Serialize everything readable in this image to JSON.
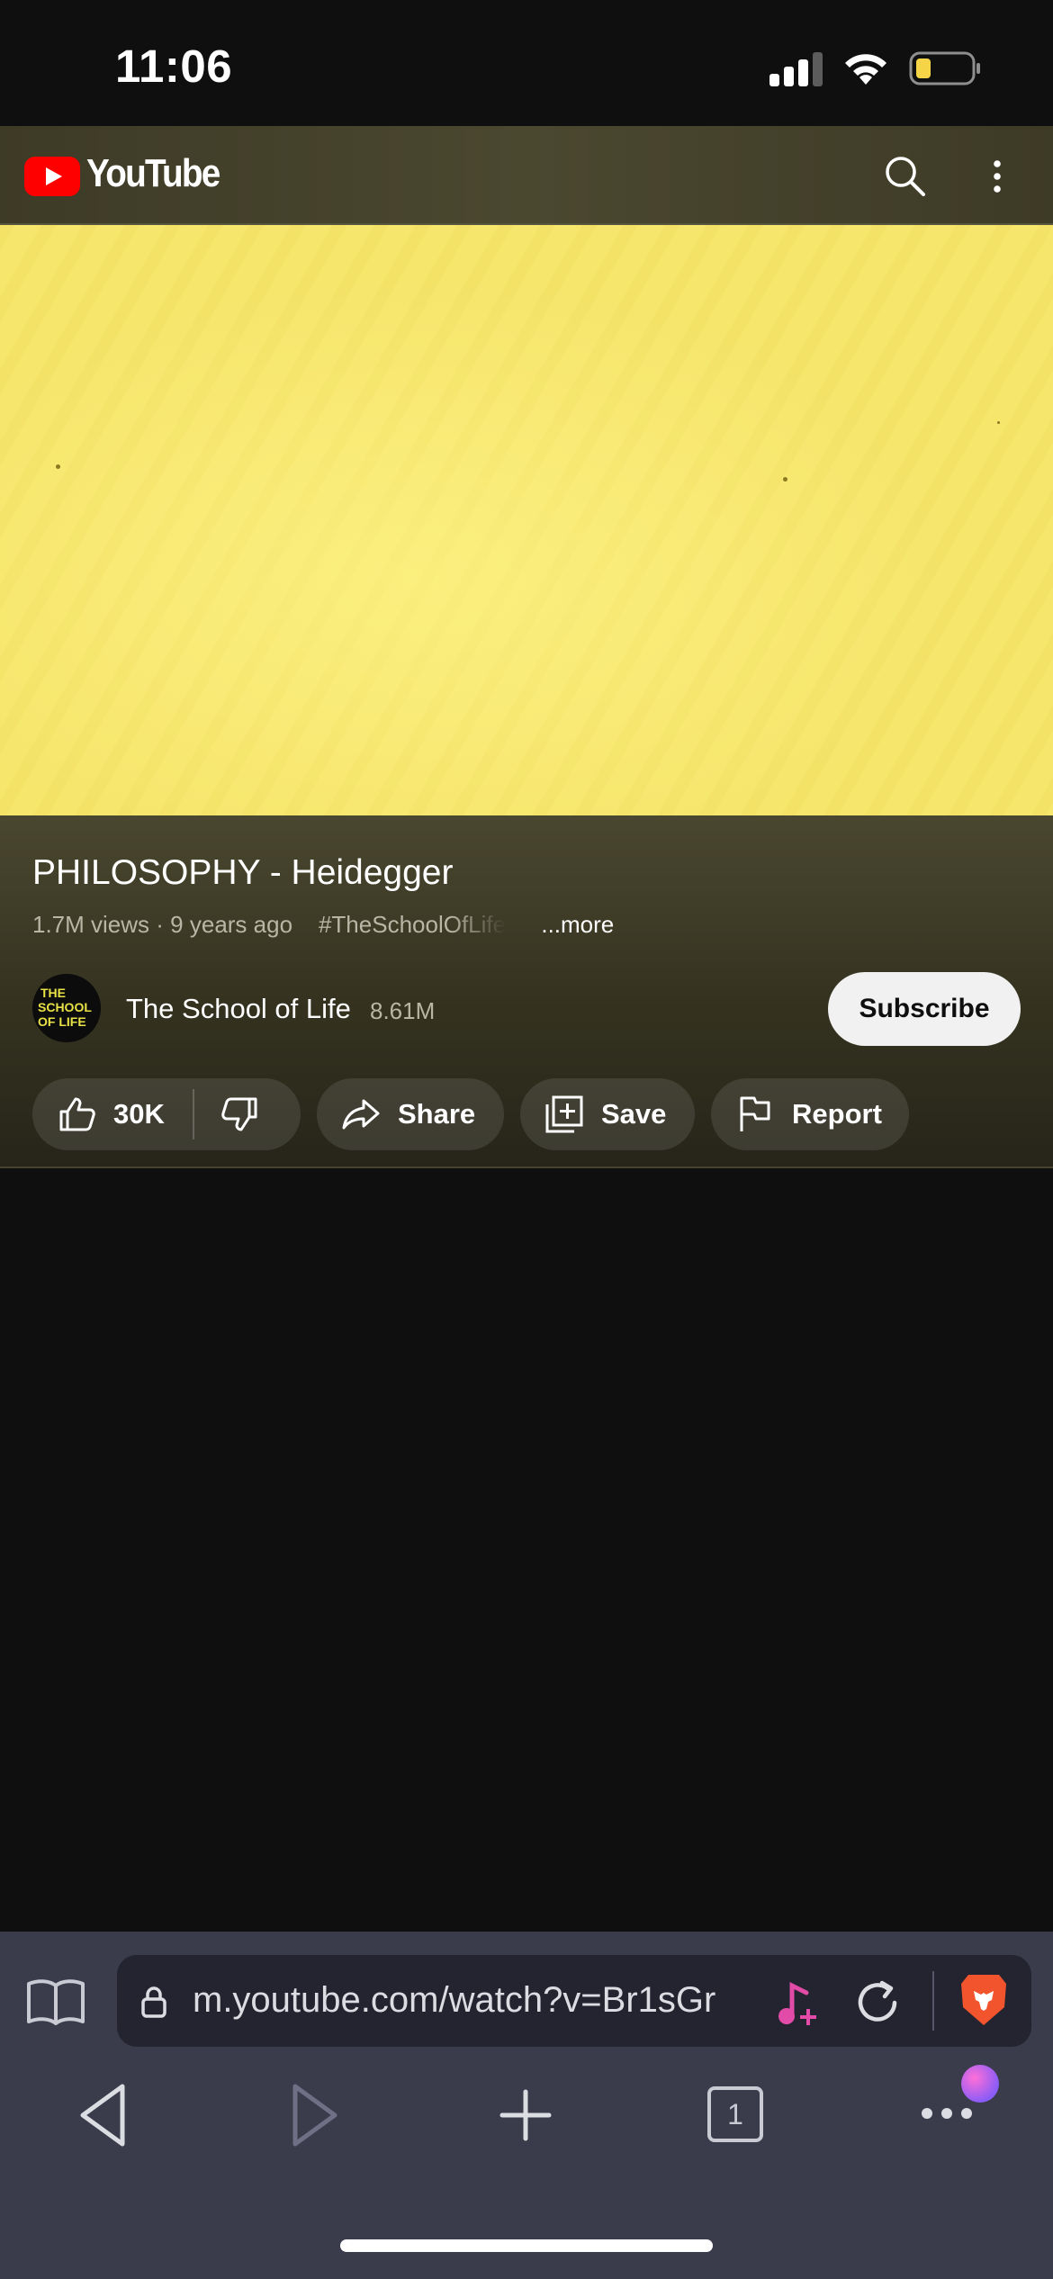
{
  "status_bar": {
    "time": "11:06"
  },
  "header": {
    "logo_text": "YouTube",
    "icons": [
      "youtube-logo-icon",
      "search-icon",
      "more-vert-icon"
    ]
  },
  "video": {
    "title": "PHILOSOPHY - Heidegger",
    "views": "1.7M views",
    "age": "9 years ago",
    "hashtag": "#TheSchoolOfLife",
    "more_label": "...more"
  },
  "channel": {
    "name": "The School of Life",
    "subscribers": "8.61M",
    "avatar_text": [
      "THE",
      "SCHOOL",
      "OF LIFE"
    ],
    "subscribe_label": "Subscribe"
  },
  "actions": {
    "like_count": "30K",
    "share_label": "Share",
    "save_label": "Save",
    "report_label": "Report"
  },
  "browser": {
    "url": "m.youtube.com/watch?v=Br1sGr",
    "tab_count": "1",
    "icons": [
      "bookmarks-icon",
      "lock-icon",
      "music-playlist-icon",
      "reload-icon",
      "brave-shield-icon",
      "back-icon",
      "forward-icon",
      "add-tab-icon",
      "tabs-icon",
      "menu-icon"
    ]
  },
  "colors": {
    "background": "#0f0f0f",
    "video_yellow": "#f5e46a",
    "youtube_red": "#ff0000",
    "browser_bar": "#3a3b4b",
    "subscribe_bg": "#f1f1f1"
  }
}
